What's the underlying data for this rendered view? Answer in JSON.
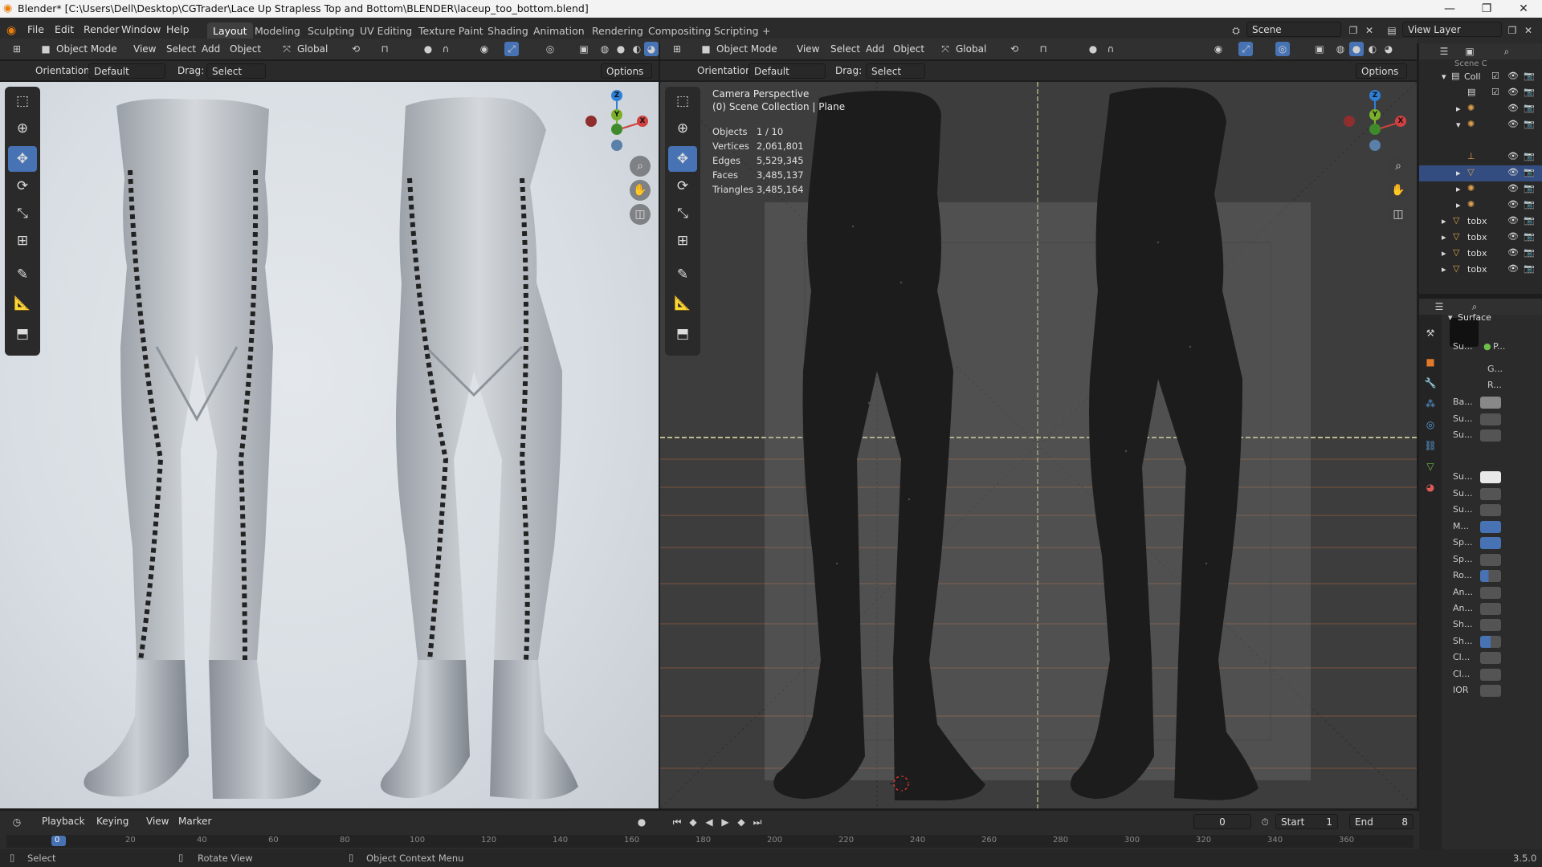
{
  "titlebar": {
    "title": "Blender* [C:\\Users\\Dell\\Desktop\\CGTrader\\Lace Up Strapless Top and Bottom\\BLENDER\\laceup_too_bottom.blend]",
    "minimize": "—",
    "maximize": "❐",
    "close": "✕"
  },
  "menubar": {
    "menus": [
      "File",
      "Edit",
      "Render",
      "Window",
      "Help"
    ],
    "workspaces": [
      "Layout",
      "Modeling",
      "Sculpting",
      "UV Editing",
      "Texture Paint",
      "Shading",
      "Animation",
      "Rendering",
      "Compositing",
      "Scripting"
    ],
    "add_workspace": "+",
    "scene_label": "Scene",
    "view_layer_label": "View Layer"
  },
  "viewport_left": {
    "mode": "Object Mode",
    "menus": [
      "View",
      "Select",
      "Add",
      "Object"
    ],
    "transform": "Global",
    "orientation_label": "Orientation:",
    "orientation_value": "Default",
    "drag_label": "Drag:",
    "drag_value": "Select Box",
    "options": "Options"
  },
  "viewport_right": {
    "mode": "Object Mode",
    "menus": [
      "View",
      "Select",
      "Add",
      "Object"
    ],
    "transform": "Global",
    "orientation_label": "Orientation:",
    "orientation_value": "Default",
    "drag_label": "Drag:",
    "drag_value": "Select Box",
    "options": "Options",
    "perspective": "Camera Perspective",
    "collection_info": "(0) Scene Collection | Plane",
    "stats": [
      {
        "label": "Objects",
        "value": "1 / 10"
      },
      {
        "label": "Vertices",
        "value": "2,061,801"
      },
      {
        "label": "Edges",
        "value": "5,529,345"
      },
      {
        "label": "Faces",
        "value": "3,485,137"
      },
      {
        "label": "Triangles",
        "value": "3,485,164"
      }
    ]
  },
  "gizmo": {
    "x": "X",
    "y": "Y",
    "z": "Z"
  },
  "outliner": {
    "header_label": "Scene C",
    "collection_label": "Coll",
    "rows": [
      "tobx",
      "tobx",
      "tobx",
      "tobx"
    ]
  },
  "properties": {
    "section": "Surface",
    "rows": [
      "Su...",
      "G...",
      "R...",
      "Ba...",
      "Su...",
      "Su...",
      "Su...",
      "Su...",
      "Su...",
      "M...",
      "Sp...",
      "Sp...",
      "Ro...",
      "An...",
      "An...",
      "Sh...",
      "Sh...",
      "Cl...",
      "Cl...",
      "IOR"
    ],
    "surface_value": "P..."
  },
  "timeline": {
    "menus": [
      "Playback",
      "Keying",
      "View",
      "Marker"
    ],
    "current_frame": "0",
    "start_label": "Start",
    "start_value": "1",
    "end_label": "End",
    "end_value": "8",
    "ruler": [
      "0",
      "20",
      "40",
      "60",
      "80",
      "100",
      "120",
      "140",
      "160",
      "180",
      "200",
      "220",
      "240",
      "260",
      "280",
      "300",
      "320",
      "340",
      "360"
    ]
  },
  "statusbar": {
    "select": "Select",
    "rotate": "Rotate View",
    "context": "Object Context Menu",
    "version": "3.5.0"
  },
  "colors": {
    "accent": "#4772b3",
    "x_axis": "#d04040",
    "y_axis": "#7ab02c",
    "z_axis": "#2f7fd6"
  }
}
